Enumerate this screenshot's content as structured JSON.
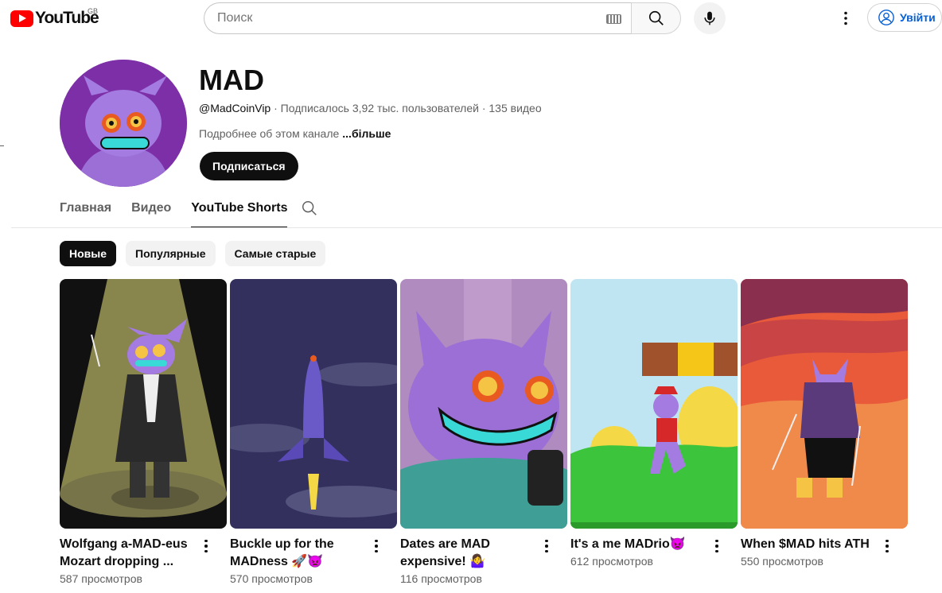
{
  "masthead": {
    "logo_text": "YouTube",
    "region": "GB",
    "search_placeholder": "Поиск",
    "signin_label": "Увійти"
  },
  "channel": {
    "title": "MAD",
    "handle": "@MadCoinVip",
    "meta_rest": " · Подписалось 3,92 тыс. пользователей · 135 видео",
    "description": "Подробнее об этом канале",
    "more_label": "...більше",
    "subscribe_label": "Подписаться"
  },
  "tabs": [
    {
      "label": "Главная",
      "active": false
    },
    {
      "label": "Видео",
      "active": false
    },
    {
      "label": "YouTube Shorts",
      "active": true
    }
  ],
  "chips": [
    {
      "label": "Новые",
      "selected": true
    },
    {
      "label": "Популярные",
      "selected": false
    },
    {
      "label": "Самые старые",
      "selected": false
    }
  ],
  "shorts": [
    {
      "title": "Wolfgang a-MAD-eus Mozart dropping ...",
      "views": "587 просмотров"
    },
    {
      "title": "Buckle up for the MADness 🚀👿",
      "views": "570 просмотров"
    },
    {
      "title": "Dates are MAD expensive! 🤷‍♀️",
      "views": "116 просмотров"
    },
    {
      "title": "It's a me MADrio👿",
      "views": "612 просмотров"
    },
    {
      "title": "When $MAD hits ATH",
      "views": "550 просмотров"
    }
  ],
  "colors": {
    "brand_red": "#ff0000",
    "link_blue": "#065fd4",
    "text_primary": "#0f0f0f",
    "text_secondary": "#606060",
    "avatar_bg": "#7d2fa7"
  }
}
